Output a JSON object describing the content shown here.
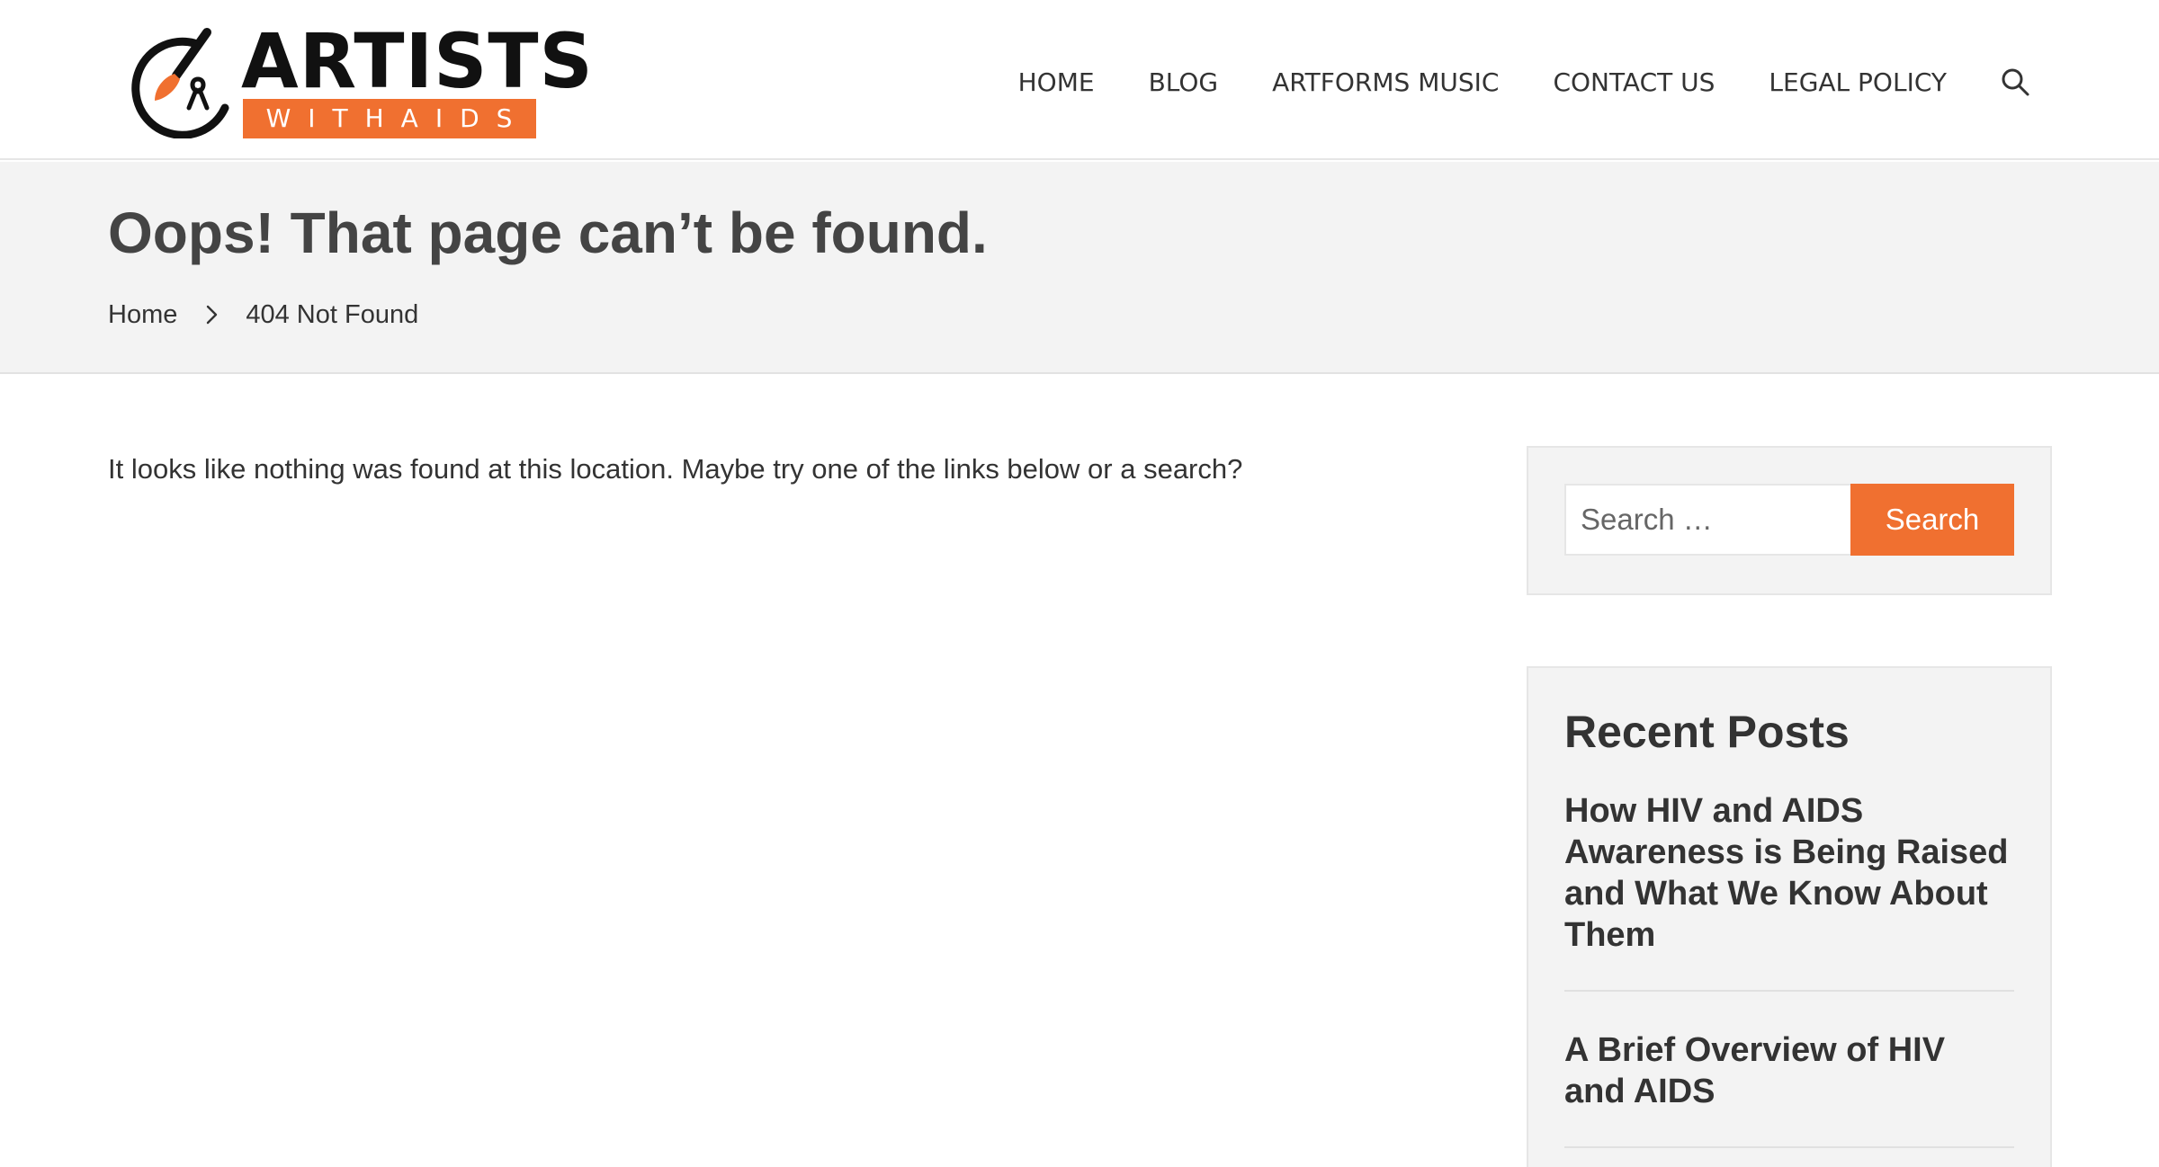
{
  "brand": {
    "name_top": "ARTISTS",
    "name_band": "WITHAIDS",
    "accent": "#f07030"
  },
  "nav": {
    "items": [
      {
        "label": "HOME"
      },
      {
        "label": "BLOG"
      },
      {
        "label": "ARTFORMS MUSIC"
      },
      {
        "label": "CONTACT US"
      },
      {
        "label": "LEGAL POLICY"
      }
    ],
    "search_icon": "search-icon"
  },
  "page": {
    "title": "Oops! That page can’t be found.",
    "breadcrumb": {
      "home": "Home",
      "separator_icon": "chevron-right-icon",
      "current": "404 Not Found"
    },
    "message": "It looks like nothing was found at this location. Maybe try one of the links below or a search?"
  },
  "sidebar": {
    "search": {
      "placeholder": "Search …",
      "button_label": "Search"
    },
    "recent_posts": {
      "title": "Recent Posts",
      "items": [
        {
          "title": "How HIV and AIDS Awareness is Being Raised and What We Know About Them"
        },
        {
          "title": "A Brief Overview of HIV and AIDS"
        }
      ]
    }
  }
}
